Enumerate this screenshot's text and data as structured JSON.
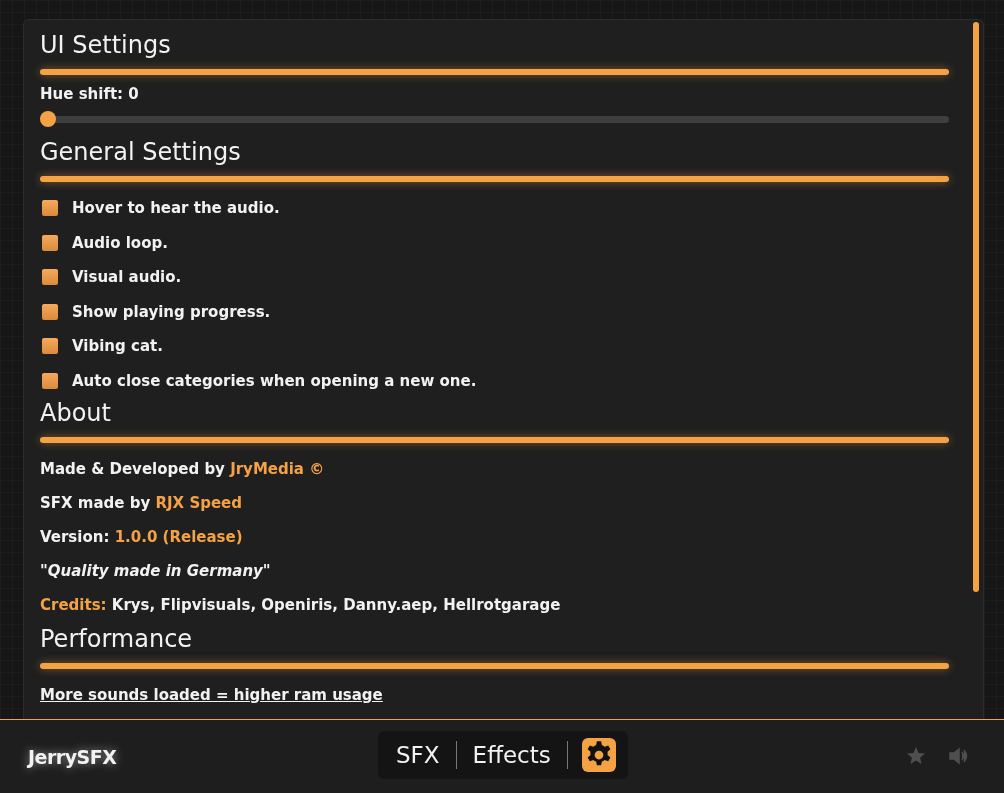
{
  "sections": [
    {
      "kind": "slider",
      "title": "UI Settings",
      "label": "Hue shift: 0",
      "level": 0
    },
    {
      "kind": "checks",
      "title": "General Settings",
      "options": [
        {
          "label": "Hover to hear the audio.",
          "checked": false
        },
        {
          "label": "Audio loop.",
          "checked": false
        },
        {
          "label": "Visual audio.",
          "checked": false
        },
        {
          "label": "Show playing progress.",
          "checked": false
        },
        {
          "label": "Vibing cat.",
          "checked": false
        },
        {
          "label": "Auto close categories when opening a new one.",
          "checked": false
        }
      ]
    },
    {
      "kind": "lines",
      "title": "About",
      "lines": [
        {
          "kind": "field",
          "label": "Made & Developed by ",
          "value": "JryMedia ©"
        },
        {
          "kind": "field",
          "label": "SFX made by ",
          "value": "RJX Speed"
        },
        {
          "kind": "field",
          "label": "Version: ",
          "value": "1.0.0 (Release)"
        },
        {
          "kind": "quote",
          "text": "\"Quality made in Germany\""
        },
        {
          "kind": "credits",
          "label": "Credits: ",
          "names": "Krys, Flipvisuals, Openiris, Danny.aep, Hellrotgarage"
        }
      ]
    },
    {
      "kind": "lines",
      "title": "Performance",
      "lines": [
        {
          "kind": "note",
          "text": "More sounds loaded = higher ram usage"
        }
      ]
    }
  ],
  "footer": {
    "logo": "JerrySFX",
    "nav": [
      {
        "label": "SFX",
        "selected": false
      },
      {
        "label": "Effects",
        "selected": false
      }
    ],
    "settings_selected": true
  }
}
